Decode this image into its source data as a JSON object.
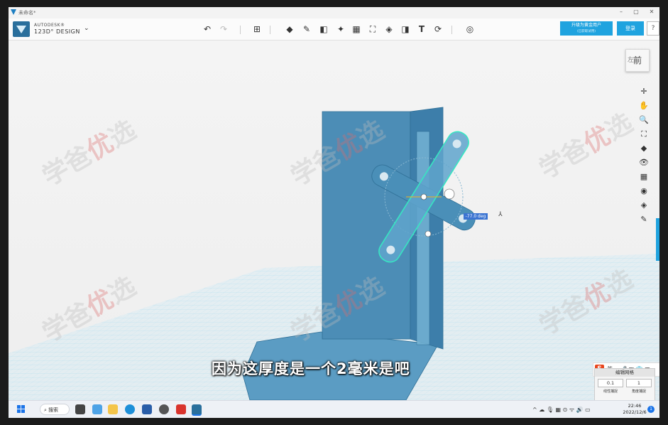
{
  "window": {
    "title": "未命名*",
    "controls": [
      "–",
      "▢",
      "✕"
    ]
  },
  "brand": {
    "line1": "AUTODESK®",
    "line2": "123D° DESIGN",
    "caret": "⌄"
  },
  "toolbar": {
    "undo": "↶",
    "redo": "↷",
    "tools": [
      {
        "name": "transform-tool",
        "glyph": "⊞"
      },
      {
        "name": "primitives-tool",
        "glyph": "◆"
      },
      {
        "name": "sketch-tool",
        "glyph": "✎"
      },
      {
        "name": "construct-tool",
        "glyph": "◧"
      },
      {
        "name": "modify-tool",
        "glyph": "✦"
      },
      {
        "name": "pattern-tool",
        "glyph": "▦"
      },
      {
        "name": "group-tool",
        "glyph": "⛶"
      },
      {
        "name": "combine-tool",
        "glyph": "◈"
      },
      {
        "name": "measure-tool",
        "glyph": "◨"
      },
      {
        "name": "text-tool",
        "glyph": "T"
      },
      {
        "name": "snap-tool",
        "glyph": "⟳"
      },
      {
        "name": "material-tool",
        "glyph": "◎"
      }
    ]
  },
  "account": {
    "upgrade_label": "升级为黄金用户",
    "upgrade_sub": "(已获取试用)",
    "login_label": "登录",
    "help_label": "?"
  },
  "viewcube": {
    "face_label": "前",
    "side_label": "左"
  },
  "nav_tools": [
    "✛",
    "✋",
    "🔍",
    "⛶",
    "◆",
    "👁",
    "▦",
    "◉",
    "◈",
    "✎"
  ],
  "angle_input": {
    "value": "-77.0 deg"
  },
  "subtitle": "因为这厚度是一个2毫米是吧",
  "ime": {
    "logo": "S",
    "rest": "英 ·, 🎤 ▦ 👕 ▦"
  },
  "grid_panel": {
    "title": "编辑网格",
    "snap_value": "0.1",
    "angle_value": "1",
    "snap_label": "线性捕捉",
    "angle_label": "角度捕捉"
  },
  "taskbar": {
    "search_label": "搜索",
    "tray": "^ ☁ 🎙 ▦ ⊙ ᯤ 🔊 ▭",
    "time": "22:46",
    "date": "2022/12/6",
    "notif": "1"
  },
  "watermark": {
    "text_a": "学爸",
    "text_b": "优",
    "text_c": "选"
  },
  "colors": {
    "accent": "#1fa3df",
    "model": "#4a8fb8",
    "selected_edge": "#37e6c2",
    "grid": "#a7dbef"
  }
}
